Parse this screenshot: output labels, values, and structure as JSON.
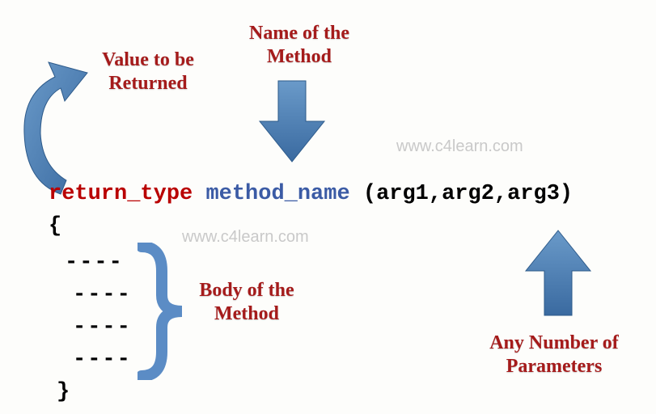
{
  "labels": {
    "return_value": "Value to be\nReturned",
    "method_name_label": "Name of the\nMethod",
    "body_label": "Body of the\nMethod",
    "params_label": "Any Number of\nParameters"
  },
  "code": {
    "return_type": "return_type",
    "method_name": "method_name",
    "args": "(arg1,arg2,arg3)",
    "open_brace": "{",
    "close_brace": "}",
    "body_dash": "----"
  },
  "watermark": "www.c4learn.com",
  "colors": {
    "label_red": "#a51b1b",
    "code_red": "#b90000",
    "code_blue": "#3b5ba5",
    "arrow_blue": "#4577b3",
    "brace_blue": "#5b8cc5"
  }
}
